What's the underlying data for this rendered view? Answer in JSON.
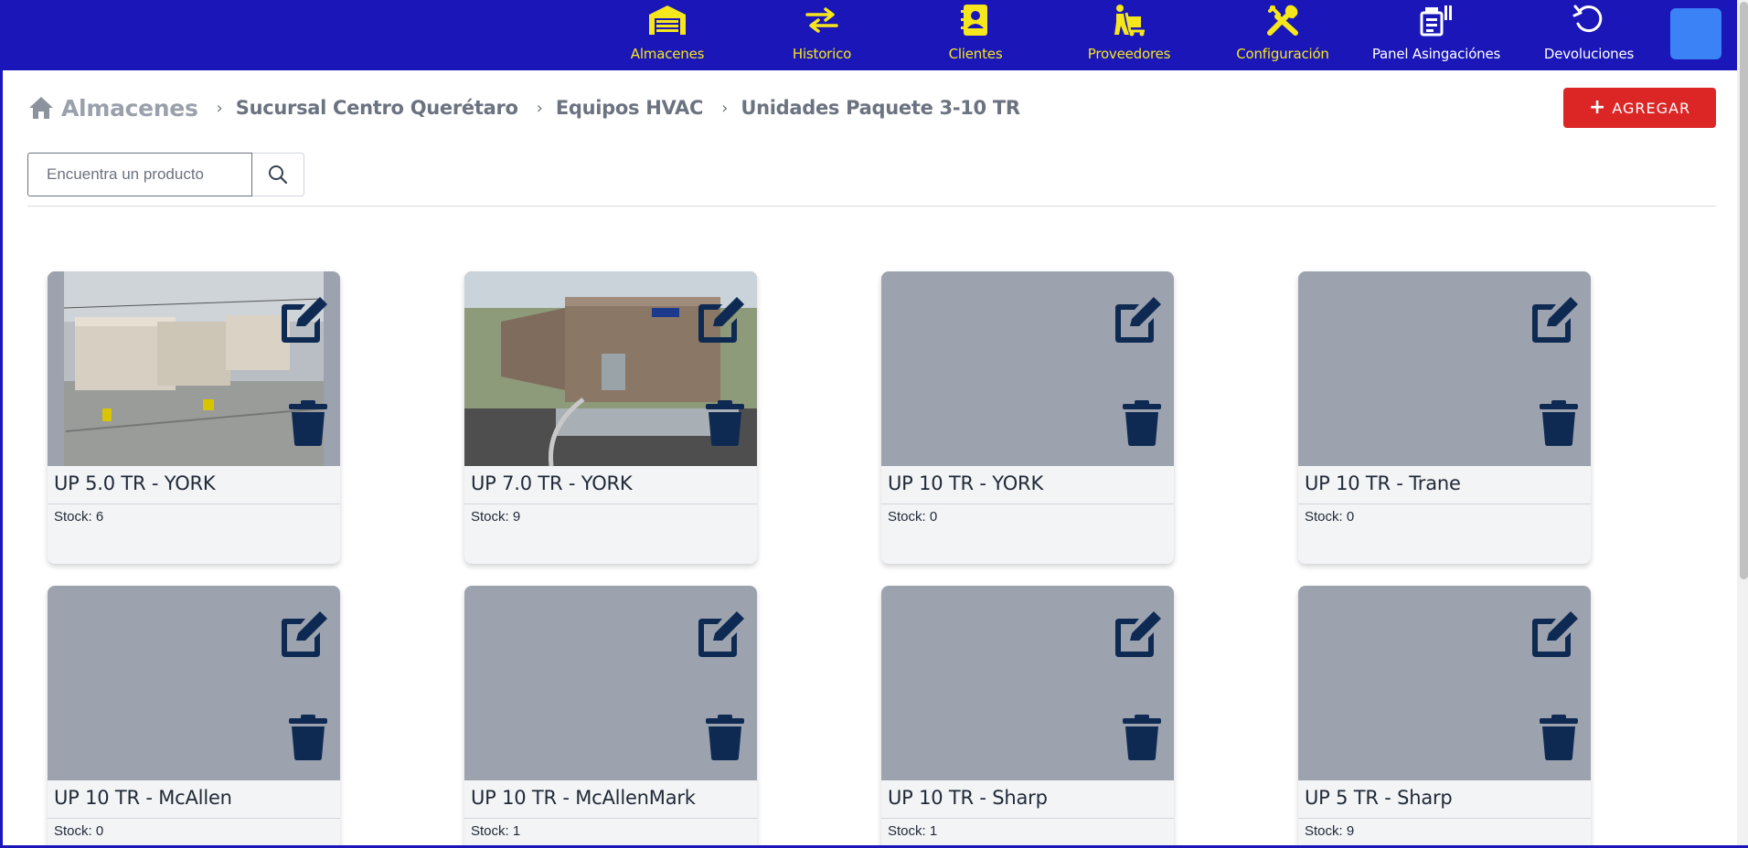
{
  "nav": {
    "items": [
      {
        "label": "Almacenes",
        "icon": "warehouse-icon"
      },
      {
        "label": "Historico",
        "icon": "swap-arrows-icon"
      },
      {
        "label": "Clientes",
        "icon": "address-book-icon"
      },
      {
        "label": "Proveedores",
        "icon": "supplier-dolly-icon"
      },
      {
        "label": "Configuración",
        "icon": "tools-icon"
      },
      {
        "label": "Panel Asingaciónes",
        "icon": "assignment-panel-icon"
      },
      {
        "label": "Devoluciones",
        "icon": "undo-icon"
      }
    ],
    "colors": {
      "bar": "#1a16b8",
      "label": "#f6e61c",
      "avatar": "#3b82f6"
    }
  },
  "breadcrumb": {
    "root": "Almacenes",
    "items": [
      "Sucursal Centro Querétaro",
      "Equipos HVAC",
      "Unidades Paquete 3-10 TR"
    ]
  },
  "toolbar": {
    "add_label": "AGREGAR",
    "add_color": "#dc2626"
  },
  "search": {
    "placeholder": "Encuentra un producto",
    "value": ""
  },
  "products": [
    {
      "name": "UP 5.0 TR - YORK",
      "stock": "Stock: 6",
      "image": "rooftop-units-photo"
    },
    {
      "name": "UP 7.0 TR - YORK",
      "stock": "Stock: 9",
      "image": "york-unit-photo"
    },
    {
      "name": "UP 10 TR - YORK",
      "stock": "Stock: 0",
      "image": ""
    },
    {
      "name": "UP 10 TR - Trane",
      "stock": "Stock: 0",
      "image": ""
    },
    {
      "name": "UP 10 TR - McAllen",
      "stock": "Stock: 0",
      "image": ""
    },
    {
      "name": "UP 10 TR - McAllenMark",
      "stock": "Stock: 1",
      "image": ""
    },
    {
      "name": "UP 10 TR - Sharp",
      "stock": "Stock: 1",
      "image": ""
    },
    {
      "name": "UP 5 TR - Sharp",
      "stock": "Stock: 9",
      "image": ""
    }
  ],
  "icon_color": "#0f2a52"
}
